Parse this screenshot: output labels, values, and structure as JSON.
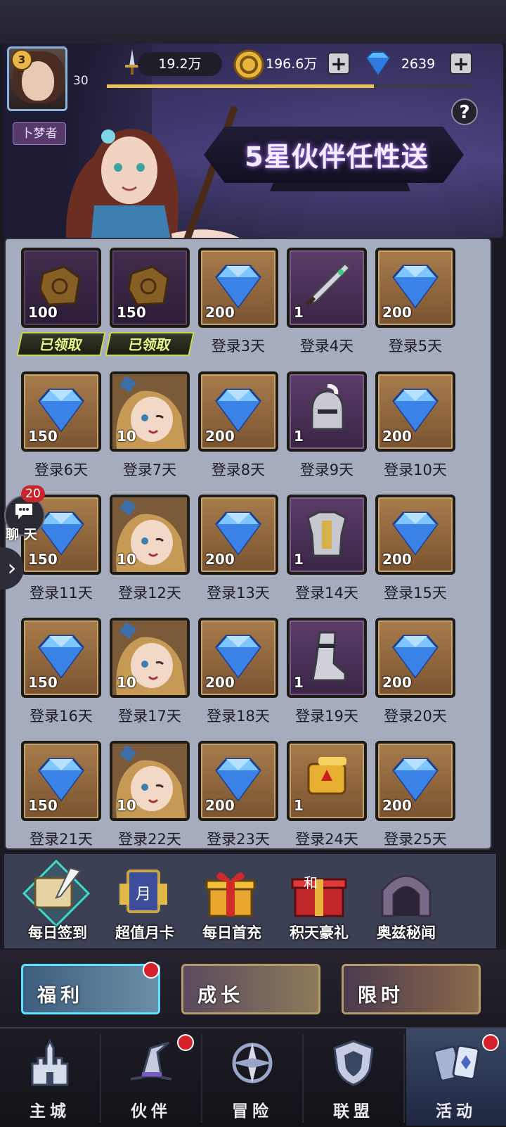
{
  "header": {
    "level": "3",
    "player_name": "卜梦者",
    "xp_level": "30",
    "xp_fraction": 0.73,
    "power": "19.2万",
    "gold": "196.6万",
    "diamonds": "2639",
    "plus": "+",
    "help": "?"
  },
  "banner": {
    "title": "5星伙伴任性送"
  },
  "calendar": [
    {
      "icon": "scroll",
      "frame": "purple",
      "qty": "100",
      "label": "已领取",
      "claimed": true
    },
    {
      "icon": "scroll",
      "frame": "purple",
      "qty": "150",
      "label": "已领取",
      "claimed": true
    },
    {
      "icon": "diamond",
      "frame": "gold",
      "qty": "200",
      "label": "登录3天"
    },
    {
      "icon": "sword",
      "frame": "purple",
      "qty": "1",
      "label": "登录4天"
    },
    {
      "icon": "diamond",
      "frame": "gold",
      "qty": "200",
      "label": "登录5天"
    },
    {
      "icon": "diamond",
      "frame": "gold",
      "qty": "150",
      "label": "登录6天"
    },
    {
      "icon": "hero",
      "frame": "gold",
      "qty": "10",
      "label": "登录7天"
    },
    {
      "icon": "diamond",
      "frame": "gold",
      "qty": "200",
      "label": "登录8天"
    },
    {
      "icon": "helmet",
      "frame": "purple",
      "qty": "1",
      "label": "登录9天"
    },
    {
      "icon": "diamond",
      "frame": "gold",
      "qty": "200",
      "label": "登录10天"
    },
    {
      "icon": "diamond",
      "frame": "gold",
      "qty": "150",
      "label": "登录11天"
    },
    {
      "icon": "hero",
      "frame": "gold",
      "qty": "10",
      "label": "登录12天"
    },
    {
      "icon": "diamond",
      "frame": "gold",
      "qty": "200",
      "label": "登录13天"
    },
    {
      "icon": "armor",
      "frame": "purple",
      "qty": "1",
      "label": "登录14天"
    },
    {
      "icon": "diamond",
      "frame": "gold",
      "qty": "200",
      "label": "登录15天"
    },
    {
      "icon": "diamond",
      "frame": "gold",
      "qty": "150",
      "label": "登录16天"
    },
    {
      "icon": "hero",
      "frame": "gold",
      "qty": "10",
      "label": "登录17天"
    },
    {
      "icon": "diamond",
      "frame": "gold",
      "qty": "200",
      "label": "登录18天"
    },
    {
      "icon": "boot",
      "frame": "purple",
      "qty": "1",
      "label": "登录19天"
    },
    {
      "icon": "diamond",
      "frame": "gold",
      "qty": "200",
      "label": "登录20天"
    },
    {
      "icon": "diamond",
      "frame": "gold",
      "qty": "150",
      "label": "登录21天"
    },
    {
      "icon": "hero",
      "frame": "gold",
      "qty": "10",
      "label": "登录22天"
    },
    {
      "icon": "diamond",
      "frame": "gold",
      "qty": "200",
      "label": "登录23天"
    },
    {
      "icon": "golden-scroll",
      "frame": "gold",
      "qty": "1",
      "label": "登录24天"
    },
    {
      "icon": "diamond",
      "frame": "gold",
      "qty": "200",
      "label": "登录25天"
    }
  ],
  "chat": {
    "label": "聊 天",
    "badge": "20",
    "arrow": "›"
  },
  "activity_tabs": [
    {
      "label": "每日签到",
      "icon": "quill-scroll-icon",
      "selected": true
    },
    {
      "label": "超值月卡",
      "icon": "month-card-icon",
      "badge_text": "月"
    },
    {
      "label": "每日首充",
      "icon": "gift-box-icon"
    },
    {
      "label": "积天豪礼",
      "icon": "red-gift-icon",
      "badge_text": "和"
    },
    {
      "label": "奥兹秘闻",
      "icon": "archway-icon"
    }
  ],
  "sub_buttons": [
    {
      "label": "福利",
      "selected": true,
      "dot": true
    },
    {
      "label": "成长",
      "dot": false
    },
    {
      "label": "限时",
      "dot": false
    }
  ],
  "nav": [
    {
      "label": "主城",
      "icon": "castle-icon",
      "dot": false
    },
    {
      "label": "伙伴",
      "icon": "witch-hat-icon",
      "dot": true
    },
    {
      "label": "冒险",
      "icon": "compass-icon",
      "dot": false
    },
    {
      "label": "联盟",
      "icon": "shield-icon",
      "dot": false
    },
    {
      "label": "活动",
      "icon": "cards-icon",
      "dot": true,
      "selected": true
    }
  ],
  "colors": {
    "accent": "#3fd7c8",
    "gold_frame": "#a77c4c",
    "purple_frame": "#5b3d68",
    "claimed": "#c9d94f",
    "badge": "#d6212a"
  }
}
